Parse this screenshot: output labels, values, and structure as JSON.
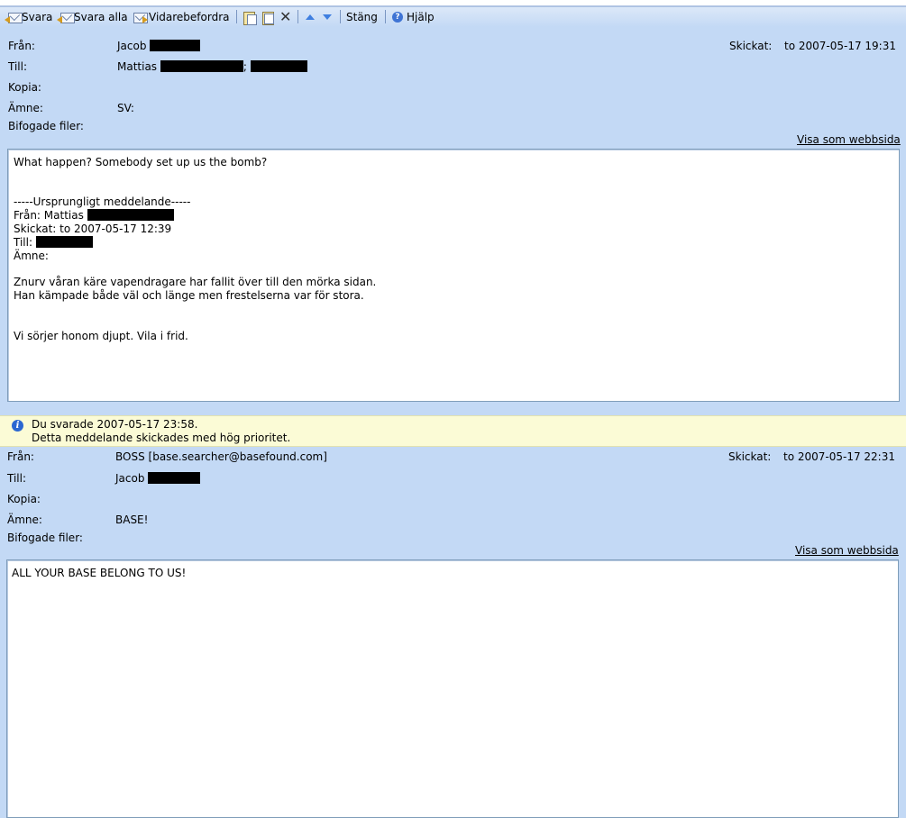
{
  "toolbar": {
    "reply": "Svara",
    "reply_all": "Svara alla",
    "forward": "Vidarebefordra",
    "close": "Stäng",
    "help": "Hjälp"
  },
  "labels": {
    "from": "Från:",
    "to": "Till:",
    "cc": "Kopia:",
    "subject": "Ämne:",
    "attachments": "Bifogade filer:",
    "sent": "Skickat:",
    "view_as_web": "Visa som webbsida"
  },
  "message1": {
    "from_name": "Jacob",
    "to_name": "Mattias",
    "to_separator": ";",
    "subject": "SV:",
    "sent_value": "to 2007-05-17 19:31",
    "body": {
      "line1": "What happen? Somebody set up us the bomb?",
      "orig_header": "-----Ursprungligt meddelande-----",
      "orig_from": "Från: Mattias",
      "orig_sent": "Skickat: to 2007-05-17 12:39",
      "orig_to": "Till:",
      "orig_subject": "Ämne:",
      "para1_l1": "Znurv våran käre vapendragare har fallit över till den mörka sidan.",
      "para1_l2": "Han kämpade både väl och länge men frestelserna var för stora.",
      "para2": "Vi sörjer honom djupt. Vila i frid."
    }
  },
  "notice": {
    "line1": "Du svarade 2007-05-17 23:58.",
    "line2": "Detta meddelande skickades med hög prioritet."
  },
  "message2": {
    "from_value": "BOSS [base.searcher@basefound.com]",
    "to_name": "Jacob",
    "subject": "BASE!",
    "sent_value": "to 2007-05-17 22:31",
    "body": "ALL YOUR BASE BELONG TO US!"
  },
  "icons": [
    "reply-icon",
    "reply-all-icon",
    "forward-icon",
    "move-icon",
    "copy-icon",
    "delete-icon",
    "previous-icon",
    "next-icon",
    "help-icon",
    "info-icon"
  ]
}
